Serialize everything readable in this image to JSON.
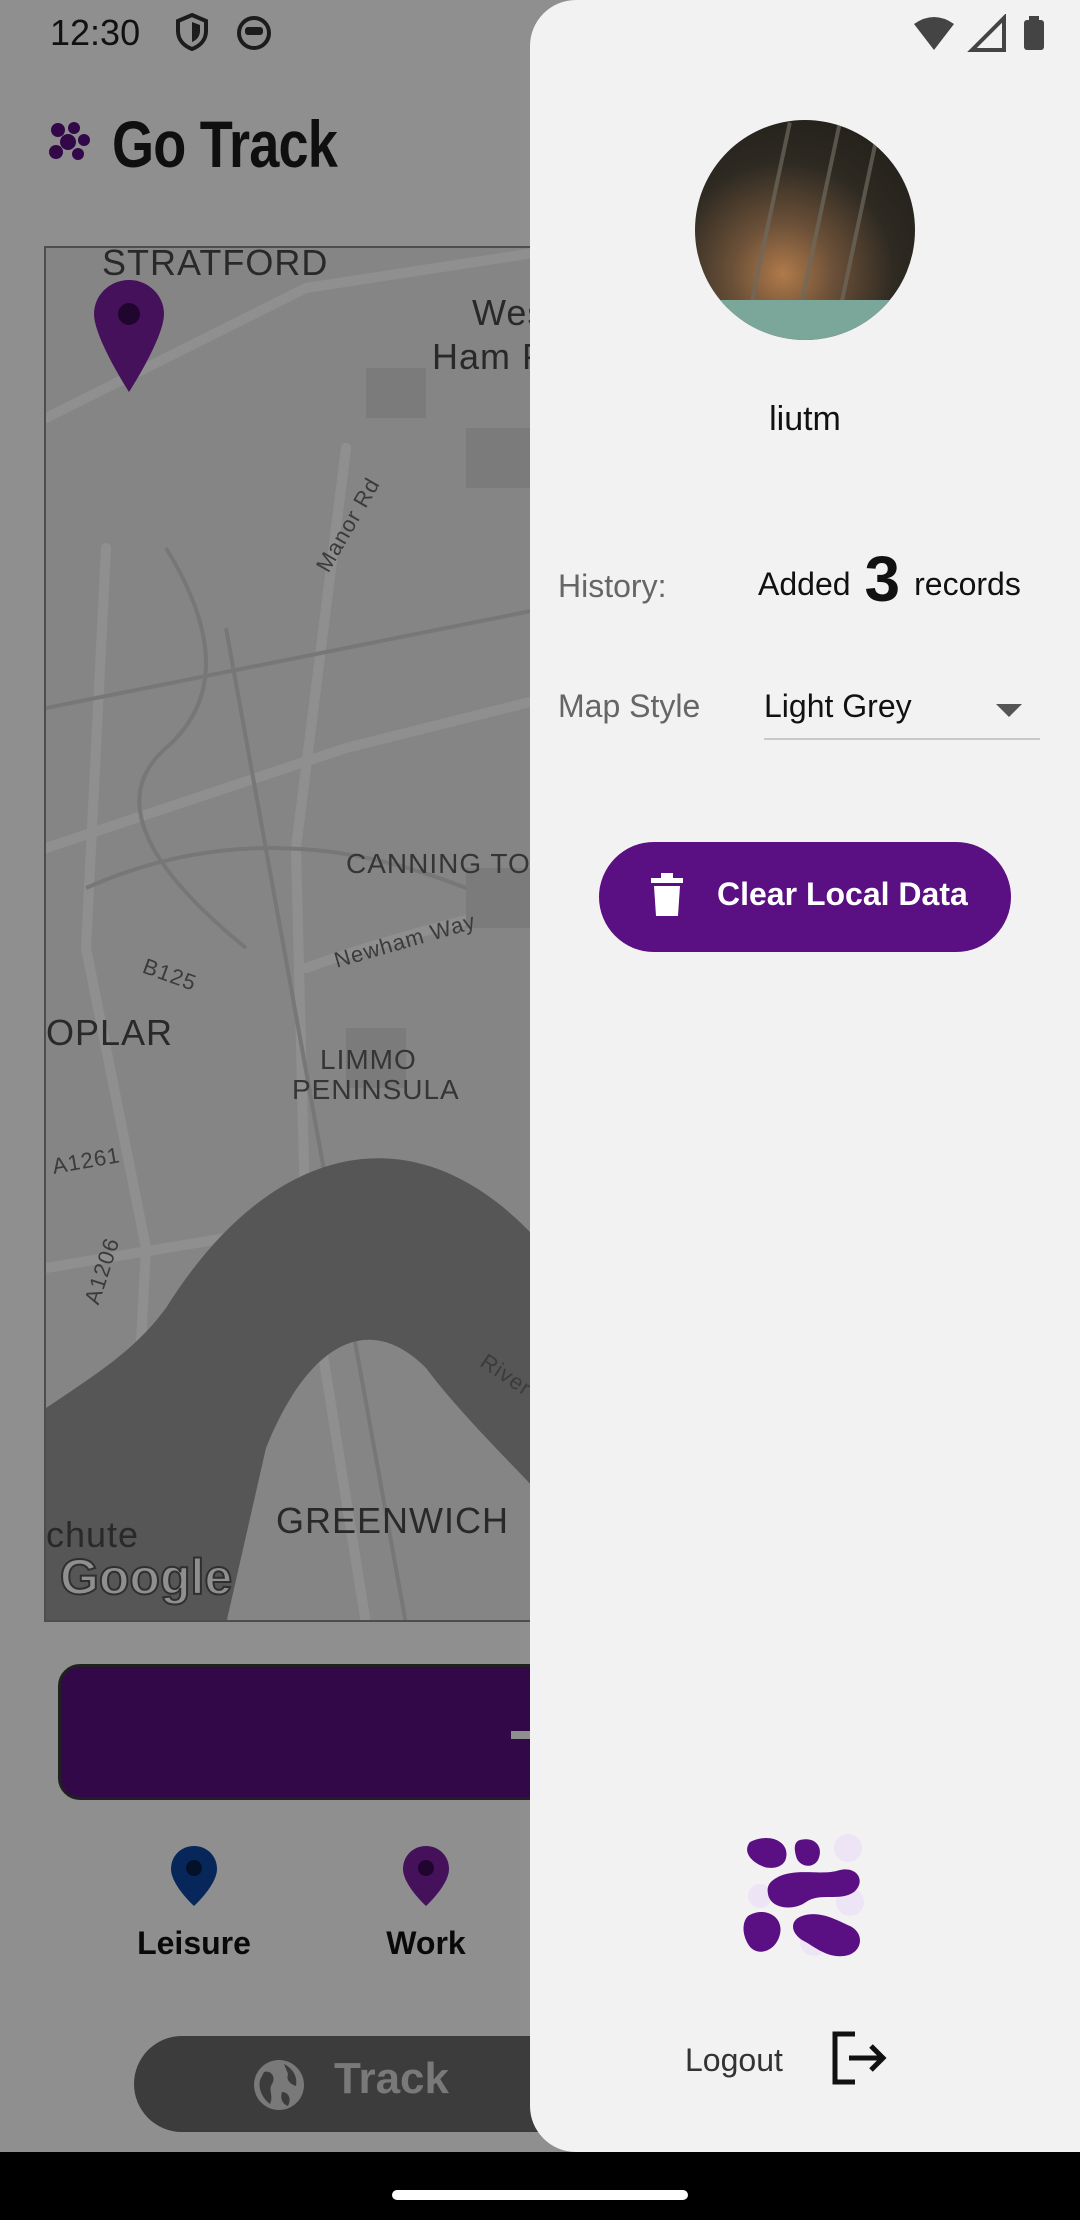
{
  "status_bar": {
    "time": "12:30"
  },
  "app": {
    "title": "Go Track",
    "map": {
      "labels": {
        "stratford": "STRATFORD",
        "west_ham_1": "Wes",
        "west_ham_2": "Ham P",
        "manor_rd": "Manor Rd",
        "canning_town": "CANNING TOWN",
        "newham_way": "Newham Way",
        "b125": "B125",
        "poplar": "OPLAR",
        "limmo_1": "LIMMO",
        "limmo_2": "PENINSULA",
        "a1261": "A1261",
        "a1206": "A1206",
        "river": "River T",
        "chute": "chute",
        "greenwich": "GREENWICH",
        "google": "Google"
      }
    },
    "categories": [
      {
        "label": "Leisure",
        "pin_color": "#0d47a1"
      },
      {
        "label": "Work",
        "pin_color": "#7b1fa2"
      }
    ],
    "bottom_button": {
      "label": "Track"
    }
  },
  "drawer": {
    "username": "liutm",
    "history": {
      "label": "History:",
      "prefix": "Added",
      "count": "3",
      "suffix": "records"
    },
    "map_style": {
      "label": "Map Style",
      "value": "Light Grey"
    },
    "clear_button": {
      "label": "Clear Local Data"
    },
    "logout": {
      "label": "Logout"
    }
  },
  "colors": {
    "accent": "#5a0f82",
    "drawer_bg": "#f2f2f3",
    "pin": "#7b1fa2"
  }
}
